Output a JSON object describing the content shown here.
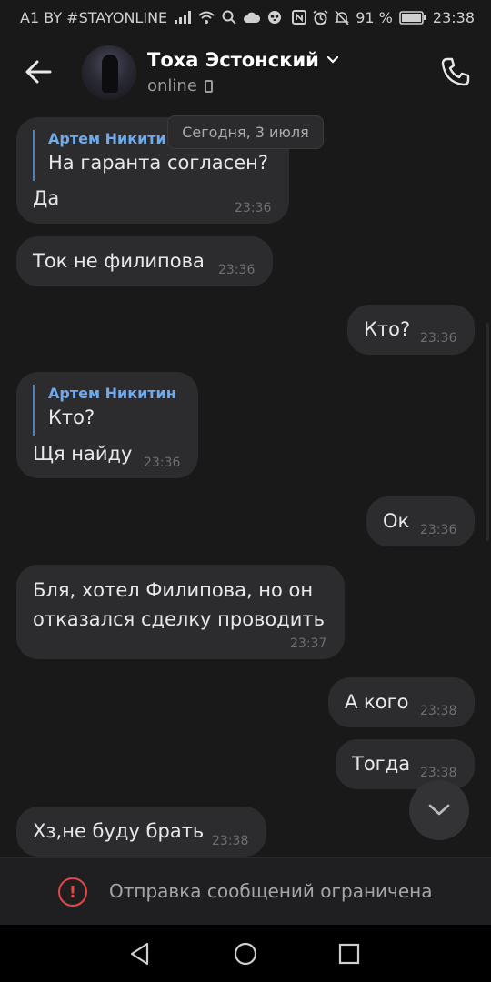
{
  "status_bar": {
    "carrier": "A1 BY #STAYONLINE",
    "battery_percent": "91 %",
    "clock": "23:38",
    "icons": [
      "signal-icon",
      "wifi-icon",
      "search-icon",
      "cloud-icon",
      "panda-icon",
      "nfc-icon",
      "alarm-icon",
      "mute-icon",
      "battery-icon"
    ]
  },
  "header": {
    "name": "Тоха Эстонский",
    "status": "online"
  },
  "date_chip": "Сегодня, 3 июля",
  "messages": [
    {
      "side": "in",
      "reply_author": "Артем Никитин",
      "reply_text": "На гаранта согласен?",
      "text": "Да",
      "time": "23:36"
    },
    {
      "side": "in",
      "text": "Ток не филипова",
      "time": "23:36"
    },
    {
      "side": "out",
      "text": "Кто?",
      "time": "23:36"
    },
    {
      "side": "in",
      "reply_author": "Артем Никитин",
      "reply_text": "Кто?",
      "text": "Щя найду",
      "time": "23:36"
    },
    {
      "side": "out",
      "text": "Ок",
      "time": "23:36"
    },
    {
      "side": "in",
      "text_line1": "Бля, хотел Филипова, но он",
      "text_line2": "отказался сделку проводить",
      "time": "23:37"
    },
    {
      "side": "out",
      "text": "А кого",
      "time": "23:38"
    },
    {
      "side": "out",
      "text": "Тогда",
      "time": "23:38"
    },
    {
      "side": "in",
      "text": "Хз,не буду брать",
      "time": "23:38"
    }
  ],
  "restriction": {
    "icon_symbol": "!",
    "text": "Отправка сообщений ограничена",
    "color": "#e64646"
  },
  "colors": {
    "background": "#191919",
    "bubble": "#2c2c2e",
    "reply_author": "#71aaeb",
    "reply_line": "#5181b8"
  }
}
